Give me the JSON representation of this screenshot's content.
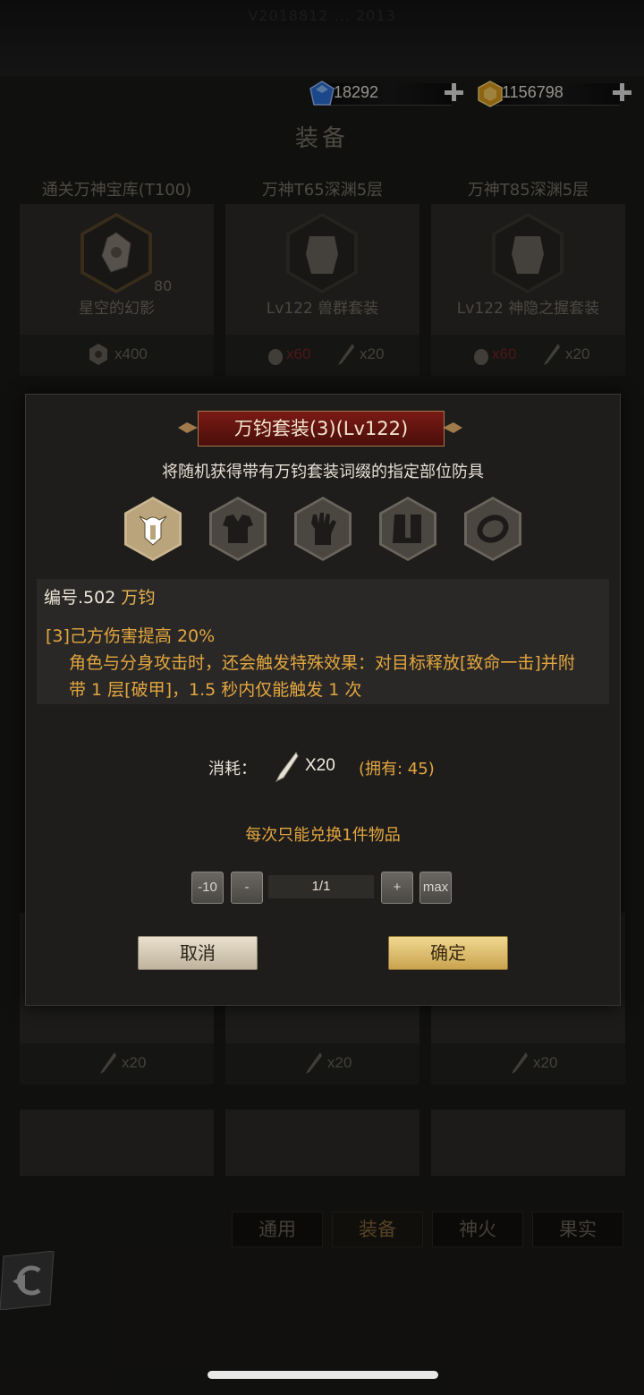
{
  "status_bar": {
    "text": "V2018812 ... 2013"
  },
  "currencies": [
    {
      "name": "diamond",
      "icon": "blue-gem-icon",
      "value": "18292"
    },
    {
      "name": "gold",
      "icon": "gold-gem-icon",
      "value": "1156798"
    }
  ],
  "page_title": "装备",
  "cards": [
    {
      "head": "通关万神宝库(T100)",
      "name": "星空的幻影",
      "level": "80",
      "costs": [
        {
          "icon": "gear-coin-icon",
          "qty": "x400",
          "insufficient": false
        }
      ]
    },
    {
      "head": "万神T65深渊5层",
      "name": "Lv122 兽群套装",
      "costs": [
        {
          "icon": "pouch-icon",
          "qty": "x60",
          "insufficient": true
        },
        {
          "icon": "feather-icon",
          "qty": "x20",
          "insufficient": false
        }
      ]
    },
    {
      "head": "万神T85深渊5层",
      "name": "Lv122 神隐之握套装",
      "costs": [
        {
          "icon": "pouch-icon",
          "qty": "x60",
          "insufficient": true
        },
        {
          "icon": "feather-icon",
          "qty": "x20",
          "insufficient": false
        }
      ]
    }
  ],
  "bottom_costs": [
    "x20",
    "x20",
    "x20"
  ],
  "tabs": [
    {
      "label": "通用",
      "active": false
    },
    {
      "label": "装备",
      "active": true
    },
    {
      "label": "神火",
      "active": false
    },
    {
      "label": "果实",
      "active": false
    }
  ],
  "modal": {
    "title": "万钧套装(3)(Lv122)",
    "description": "将随机获得带有万钧套装词缀的指定部位防具",
    "slots": [
      {
        "icon": "helmet-icon",
        "selected": true
      },
      {
        "icon": "chest-armor-icon",
        "selected": false
      },
      {
        "icon": "glove-icon",
        "selected": false
      },
      {
        "icon": "boots-icon",
        "selected": false
      },
      {
        "icon": "ring-icon",
        "selected": false
      }
    ],
    "code_prefix": "编号.502",
    "code_name": "万钧",
    "effect_line1": "[3]己方伤害提高 20%",
    "effect_line2": "角色与分身攻击时，还会触发特殊效果：对目标释放[致命一击]并附带 1 层[破甲]，1.5 秒内仅能触发 1 次",
    "cost_label": "消耗：",
    "cost_qty": "X20",
    "owned": "(拥有: 45)",
    "note": "每次只能兑换1件物品",
    "stepper": {
      "minus10": "-10",
      "minus": "-",
      "value": "1/1",
      "plus": "+",
      "max": "max"
    },
    "cancel_label": "取消",
    "confirm_label": "确定"
  }
}
